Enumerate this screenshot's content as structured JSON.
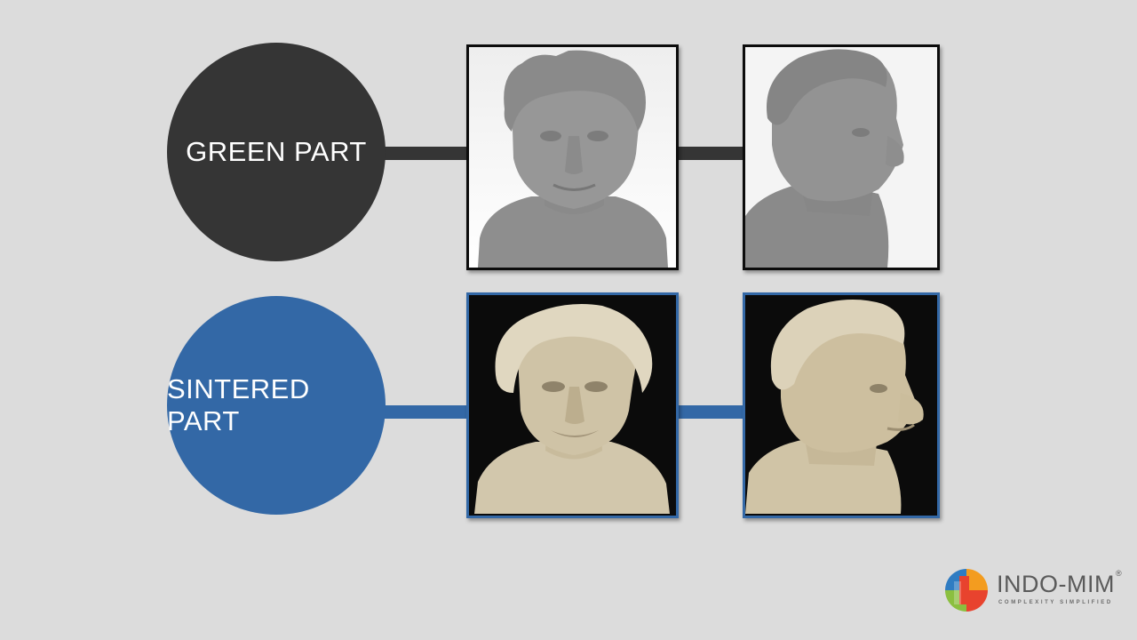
{
  "rows": [
    {
      "label": "GREEN PART",
      "color": "#353535",
      "images": [
        "green-part-front",
        "green-part-side"
      ]
    },
    {
      "label": "SINTERED PART",
      "color": "#3368a6",
      "images": [
        "sintered-part-front",
        "sintered-part-side"
      ]
    }
  ],
  "logo": {
    "name": "INDO-MIM",
    "registered": "®",
    "tagline": "COMPLEXITY SIMPLIFIED",
    "colors": [
      "#e8432e",
      "#f39c1f",
      "#8bbf3f",
      "#2f7cc2"
    ]
  }
}
